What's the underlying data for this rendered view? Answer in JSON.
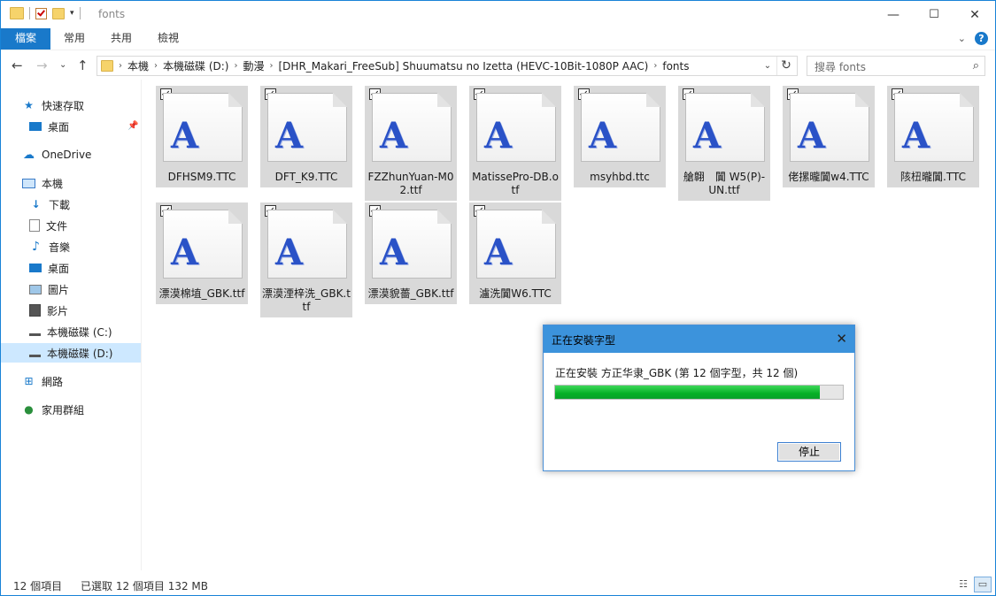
{
  "window": {
    "title": "fonts",
    "controls": {
      "minimize": "—",
      "maximize": "☐",
      "close": "✕"
    }
  },
  "ribbon": {
    "tabs": [
      "檔案",
      "常用",
      "共用",
      "檢視"
    ]
  },
  "address": {
    "crumbs": [
      "本機",
      "本機磁碟 (D:)",
      "動漫",
      "[DHR_Makari_FreeSub] Shuumatsu no Izetta (HEVC-10Bit-1080P AAC)",
      "fonts"
    ],
    "search_placeholder": "搜尋 fonts"
  },
  "nav": {
    "items": [
      {
        "label": "快速存取",
        "icon": "star-icon"
      },
      {
        "label": "桌面",
        "icon": "desktop-icon",
        "pinned": true
      },
      {
        "label": "OneDrive",
        "icon": "cloud-icon"
      },
      {
        "label": "本機",
        "icon": "computer-icon"
      },
      {
        "label": "下載",
        "icon": "download-icon"
      },
      {
        "label": "文件",
        "icon": "document-icon"
      },
      {
        "label": "音樂",
        "icon": "music-icon"
      },
      {
        "label": "桌面",
        "icon": "desktop-icon"
      },
      {
        "label": "圖片",
        "icon": "picture-icon"
      },
      {
        "label": "影片",
        "icon": "video-icon"
      },
      {
        "label": "本機磁碟 (C:)",
        "icon": "drive-icon"
      },
      {
        "label": "本機磁碟 (D:)",
        "icon": "drive-icon",
        "selected": true
      },
      {
        "label": "網路",
        "icon": "network-icon"
      },
      {
        "label": "家用群組",
        "icon": "homegroup-icon"
      }
    ]
  },
  "files": [
    {
      "name": "DFHSM9.TTC"
    },
    {
      "name": "DFT_K9.TTC"
    },
    {
      "name": "FZZhunYuan-M02.ttf"
    },
    {
      "name": "MatissePro-DB.otf"
    },
    {
      "name": "msyhbd.ttc"
    },
    {
      "name": "艙翺　闐 W5(P)-UN.ttf"
    },
    {
      "name": "佬摞曨闐w4.TTC"
    },
    {
      "name": "陔杻曨闐.TTC"
    },
    {
      "name": "漂漠棉埴_GBK.ttf"
    },
    {
      "name": "漂漠湮梓洗_GBK.ttf"
    },
    {
      "name": "漂漠貌薔_GBK.ttf"
    },
    {
      "name": "瀘洗闐W6.TTC"
    }
  ],
  "file_icon_glyph": "A",
  "status": {
    "count": "12 個項目",
    "selected": "已選取 12 個項目  132 MB"
  },
  "dialog": {
    "title": "正在安裝字型",
    "message": "正在安裝 方正华隶_GBK (第 12 個字型，共 12 個)",
    "progress": 0.92,
    "stop_label": "停止",
    "close": "✕"
  },
  "colors": {
    "accent": "#1979ca",
    "progress": "#06b025",
    "selected_tile": "#d9d9d9"
  }
}
